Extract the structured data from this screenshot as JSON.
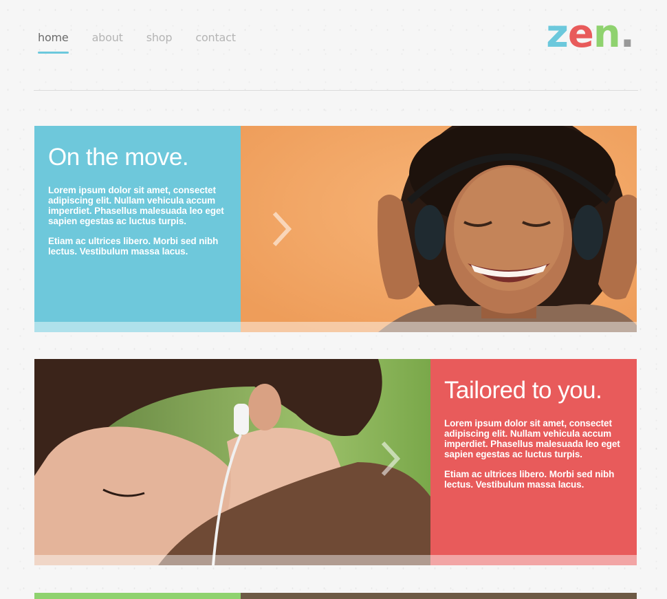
{
  "nav": {
    "items": [
      {
        "label": "home",
        "active": true
      },
      {
        "label": "about",
        "active": false
      },
      {
        "label": "shop",
        "active": false
      },
      {
        "label": "contact",
        "active": false
      }
    ]
  },
  "logo": {
    "z": "z",
    "e": "e",
    "n": "n",
    "dot": "."
  },
  "colors": {
    "blue": "#6ec8db",
    "red": "#e85b5b",
    "green": "#8fd26f",
    "nav_active": "#6a6a6a",
    "nav_inactive": "#b4b4b4"
  },
  "features": [
    {
      "title": "On the move.",
      "paragraph1": "Lorem ipsum dolor sit amet, consectet adipiscing elit. Nullam vehicula accum imperdiet. Phasellus malesuada leo eget sapien egestas ac luctus turpis.",
      "paragraph2": "Etiam ac ultrices libero. Morbi sed nibh lectus. Vestibulum massa lacus.",
      "photo": "woman-with-headphones-photo",
      "arrow_icon": "chevron-right-icon"
    },
    {
      "title": "Tailored to you.",
      "paragraph1": "Lorem ipsum dolor sit amet, consectet adipiscing elit. Nullam vehicula accum imperdiet. Phasellus malesuada leo eget sapien egestas ac luctus turpis.",
      "paragraph2": "Etiam ac ultrices libero. Morbi sed nibh lectus. Vestibulum massa lacus.",
      "photo": "woman-with-earbuds-photo",
      "arrow_icon": "chevron-right-icon"
    }
  ]
}
